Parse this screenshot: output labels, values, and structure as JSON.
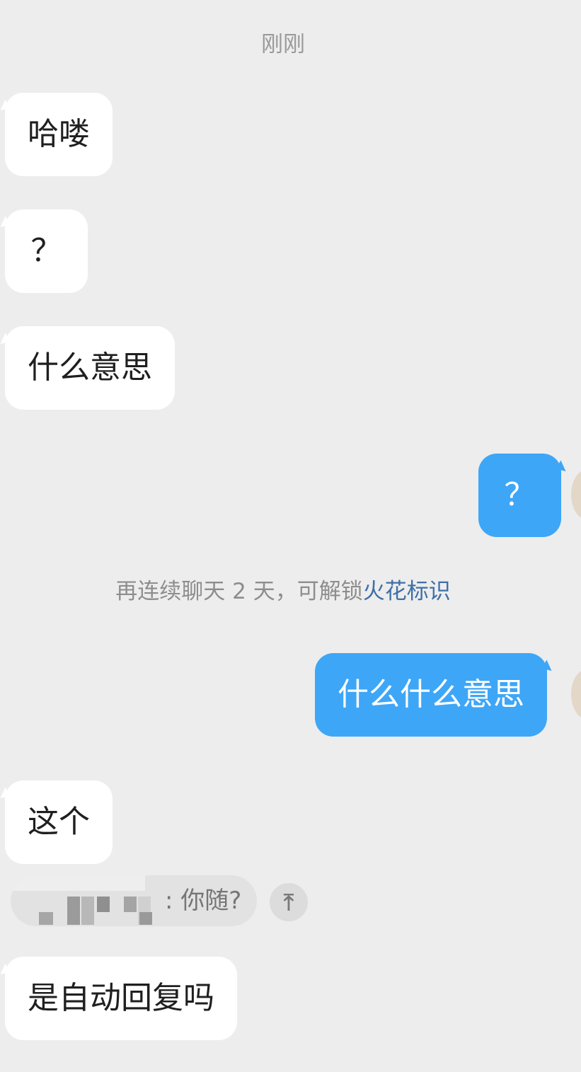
{
  "chat": {
    "timestamp": "刚刚",
    "messages": [
      {
        "side": "incoming",
        "text": "哈喽"
      },
      {
        "side": "incoming",
        "text": "？"
      },
      {
        "side": "incoming",
        "text": "什么意思"
      },
      {
        "side": "outgoing",
        "text": "？"
      },
      {
        "side": "outgoing",
        "text": "什么什么意思"
      },
      {
        "side": "incoming",
        "text": "这个"
      },
      {
        "side": "incoming",
        "text": "是自动回复吗"
      }
    ],
    "system_notice": {
      "prefix": "再连续聊天 2 天，可解锁",
      "link": "火花标识"
    },
    "quote": {
      "text": ": 你随?",
      "jump_icon": "arrow-up-to-top-icon"
    }
  },
  "colors": {
    "background": "#ededed",
    "incoming_bubble": "#ffffff",
    "outgoing_bubble": "#3ea6f7",
    "link": "#3f6fa8"
  }
}
